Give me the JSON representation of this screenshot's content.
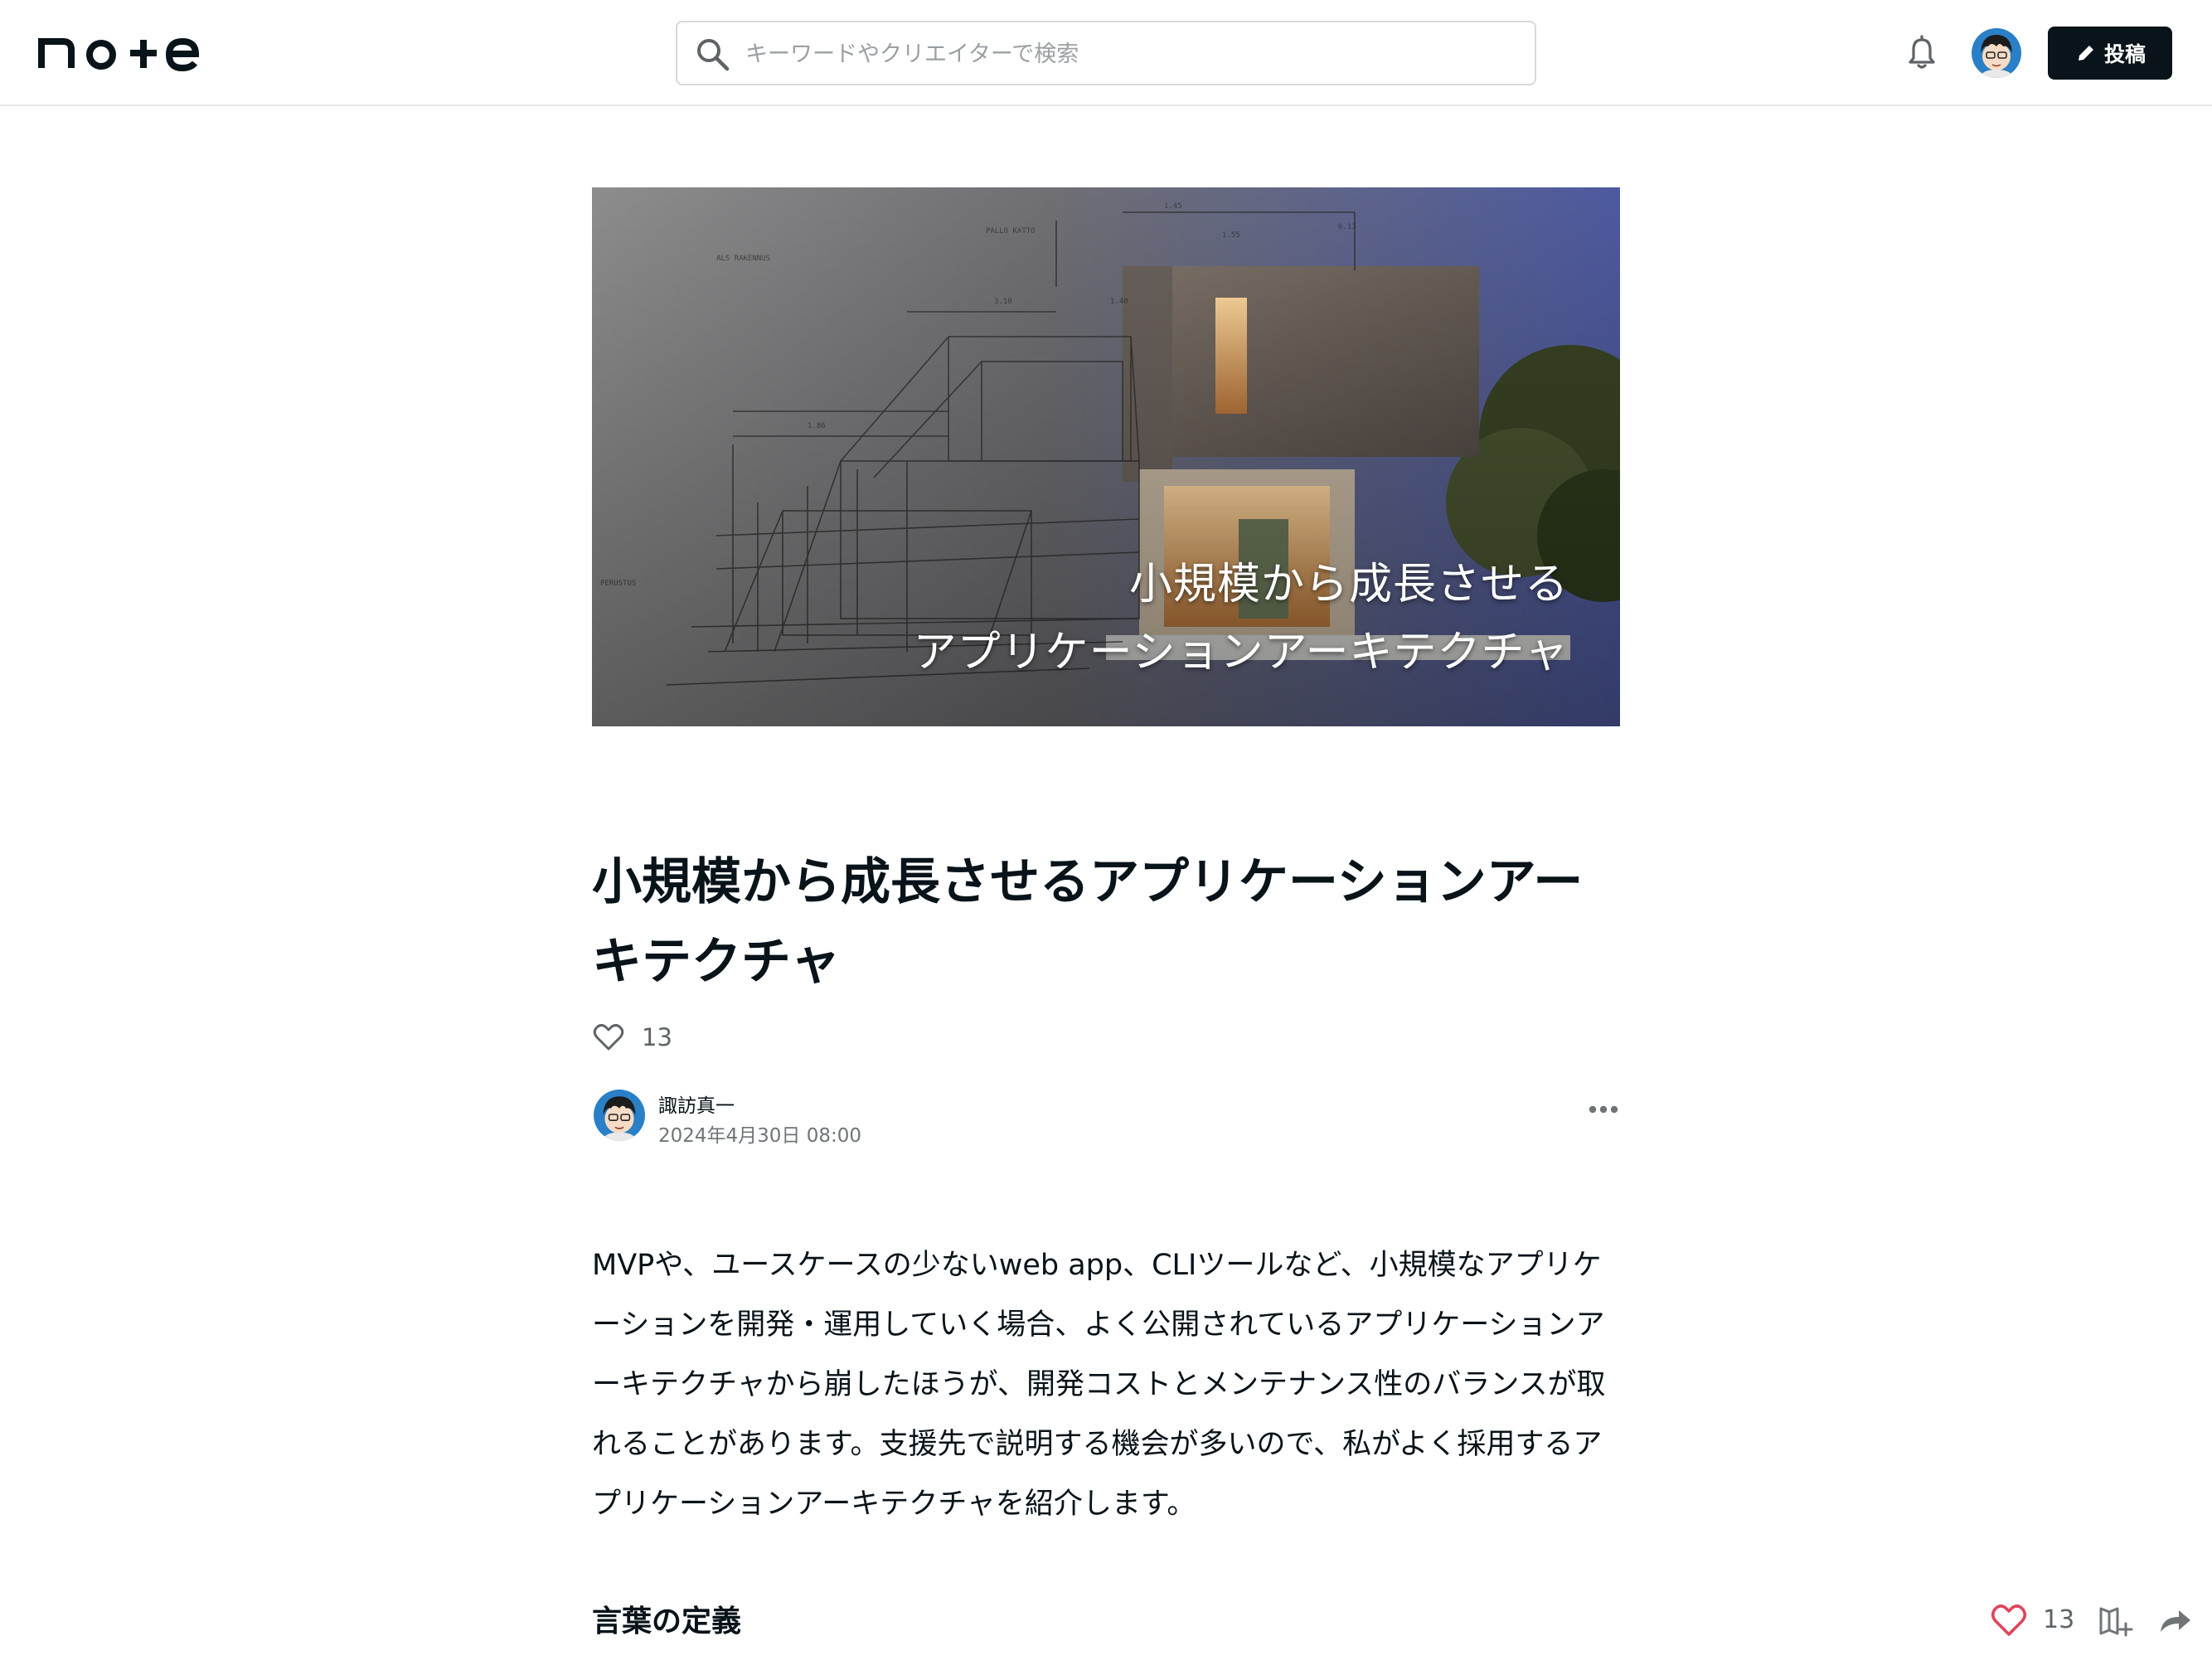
{
  "header": {
    "logo_text": "note",
    "search_placeholder": "キーワードやクリエイターで検索",
    "post_button_label": "投稿",
    "icons": [
      "search-icon",
      "bell-icon",
      "pencil-icon"
    ]
  },
  "hero": {
    "caption_line1": "小規模から成長させる",
    "caption_line2": "アプリケーションアーキテクチャ"
  },
  "article": {
    "title": "小規模から成長させるアプリケーションアーキテクチャ",
    "like_count": "13",
    "author_name": "諏訪真一",
    "published_at": "2024年4月30日 08:00",
    "body": "MVPや、ユースケースの少ないweb app、CLIツールなど、小規模なアプリケーションを開発・運用していく場合、よく公開されているアプリケーションアーキテクチャから崩したほうが、開発コストとメンテナンス性のバランスが取れることがあります。支援先で説明する機会が多いので、私がよく採用するアプリケーションアーキテクチャを紹介します。",
    "section_heading": "言葉の定義"
  },
  "action_bar": {
    "like_count": "13"
  },
  "colors": {
    "text_primary": "#08131a",
    "text_muted": "#6f7477",
    "post_button_bg": "#08131a",
    "like_active": "#e0445b",
    "border": "#d9d9d9"
  }
}
